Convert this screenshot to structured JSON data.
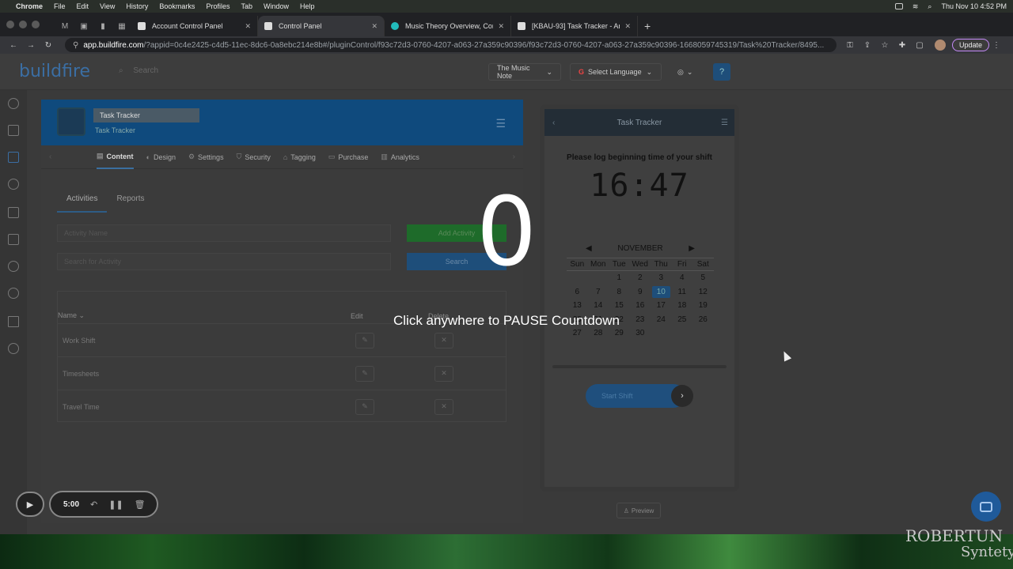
{
  "menubar": {
    "app": "Chrome",
    "items": [
      "File",
      "Edit",
      "View",
      "History",
      "Bookmarks",
      "Profiles",
      "Tab",
      "Window",
      "Help"
    ],
    "datetime": "Thu Nov 10  4:52 PM"
  },
  "tabs": [
    {
      "title": "Account Control Panel",
      "active": false
    },
    {
      "title": "Control Panel",
      "active": true
    },
    {
      "title": "Music Theory Overview, Conce",
      "active": false
    },
    {
      "title": "[KBAU-93] Task Tracker - Artic",
      "active": false
    }
  ],
  "address": {
    "domain": "app.buildfire.com",
    "path": "/?appid=0c4e2425-c4d5-11ec-8dc6-0a8ebc214e8b#/pluginControl/f93c72d3-0760-4207-a063-27a359c90396/f93c72d3-0760-4207-a063-27a359c90396-1668059745319/Task%20Tracker/8495...",
    "update_label": "Update"
  },
  "header": {
    "logo": "buildfire",
    "search_placeholder": "Search",
    "app_selector": "The Music Note",
    "language_selector": "Select Language",
    "google_glyph": "G"
  },
  "plugin": {
    "title": "Task Tracker",
    "subtitle": "Task Tracker",
    "tabs": [
      "Content",
      "Design",
      "Settings",
      "Security",
      "Tagging",
      "Purchase",
      "Analytics"
    ],
    "active_tab": "Content",
    "subtabs": [
      "Activities",
      "Reports"
    ],
    "activity_name_placeholder": "Activity Name",
    "search_placeholder": "Search for Activity",
    "add_button": "Add Activity",
    "search_button": "Search",
    "table": {
      "headers": {
        "name": "Name",
        "edit": "Edit",
        "delete": "Delete"
      },
      "rows": [
        "Work Shift",
        "Timesheets",
        "Travel Time"
      ]
    }
  },
  "phone": {
    "title": "Task Tracker",
    "prompt": "Please log beginning time of your shift",
    "clock": "16:47",
    "calendar": {
      "month": "NOVEMBER",
      "days_of_week": [
        "Sun",
        "Mon",
        "Tue",
        "Wed",
        "Thu",
        "Fri",
        "Sat"
      ],
      "leading_blanks": 2,
      "days": [
        "1",
        "2",
        "3",
        "4",
        "5",
        "6",
        "7",
        "8",
        "9",
        "10",
        "11",
        "12",
        "13",
        "14",
        "15",
        "16",
        "17",
        "18",
        "19",
        "20",
        "21",
        "22",
        "23",
        "24",
        "25",
        "26",
        "27",
        "28",
        "29",
        "30"
      ],
      "selected": "10"
    },
    "start_button": "Start Shift",
    "preview_button": "Preview"
  },
  "overlay": {
    "countdown": "0",
    "message": "Click anywhere to PAUSE Countdown"
  },
  "recorder": {
    "time": "5:00"
  },
  "wallpaper": {
    "text1": "ROBERTUN",
    "text2": "Syntety"
  }
}
